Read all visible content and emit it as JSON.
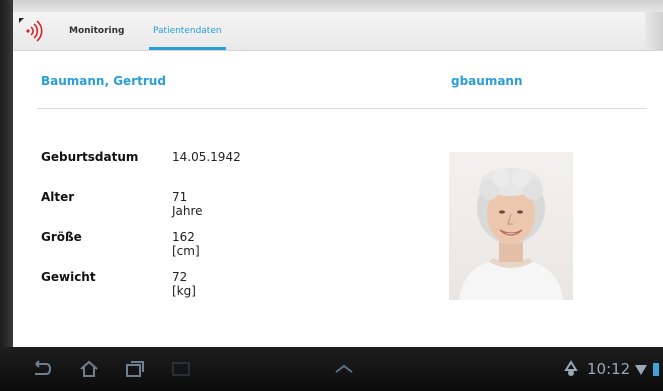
{
  "tabs": {
    "monitoring": "Monitoring",
    "patient_data": "Patientendaten"
  },
  "patient": {
    "name": "Baumann, Gertrud",
    "username": "gbaumann"
  },
  "details": [
    {
      "label": "Geburtsdatum",
      "value": "14.05.1942"
    },
    {
      "label": "Alter",
      "value": "71 Jahre"
    },
    {
      "label": "Größe",
      "value": "162 [cm]"
    },
    {
      "label": "Gewicht",
      "value": "72 [kg]"
    }
  ],
  "system_bar": {
    "clock": "10:12"
  },
  "colors": {
    "accent": "#2a9fd6",
    "logo_red": "#d8232a"
  },
  "icons": [
    "wireless-logo-icon",
    "back-icon",
    "home-icon",
    "recent-apps-icon",
    "screenshot-icon",
    "chevron-up-icon",
    "recycle-icon",
    "wifi-icon",
    "battery-icon"
  ]
}
